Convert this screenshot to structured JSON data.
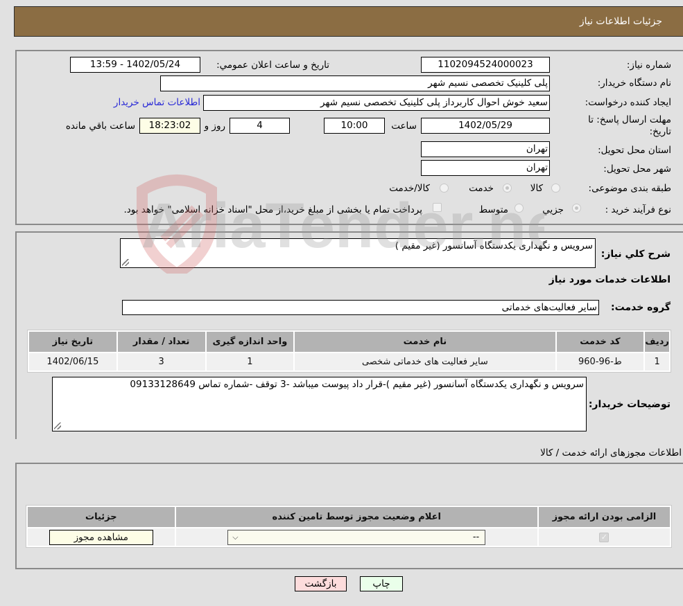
{
  "header": {
    "title": "جزئیات اطلاعات نیاز"
  },
  "details": {
    "need_number_label": "شماره نیاز:",
    "need_number": "1102094524000023",
    "announce_label": "تاريخ و ساعت اعلان عمومي:",
    "announce_value": "1402/05/24 - 13:59",
    "buyer_org_label": "نام دستگاه خریدار:",
    "buyer_org": "پلی کلینیک تخصصی نسیم شهر",
    "requester_label": "ایجاد کننده درخواست:",
    "requester": "سعید خوش احوال کاربرداز پلی کلینیک تخصصی نسیم شهر",
    "buyer_contact_link": "اطلاعات تماس خریدار",
    "deadline_label": "مهلت ارسال پاسخ: تا تاریخ:",
    "deadline_date": "1402/05/29",
    "time_label": "ساعت",
    "deadline_time": "10:00",
    "days": "4",
    "days_label": "روز و",
    "remaining_time": "18:23:02",
    "remaining_label": "ساعت باقي مانده",
    "province_label": "استان محل تحویل:",
    "province": "تهران",
    "city_label": "شهر محل تحویل:",
    "city": "تهران",
    "category_label": "طبقه بندی موضوعی:",
    "category_options": [
      {
        "label": "کالا",
        "checked": false
      },
      {
        "label": "خدمت",
        "checked": true
      },
      {
        "label": "کالا/خدمت",
        "checked": false
      }
    ],
    "purchase_type_label": "نوع فرآیند خرید :",
    "purchase_type_options": [
      {
        "label": "جزيي",
        "checked": true
      },
      {
        "label": "متوسط",
        "checked": false
      }
    ],
    "treasury_note": "پرداخت تمام یا بخشی از مبلغ خرید،از محل \"اسناد خزانه اسلامی\" خواهد بود."
  },
  "need": {
    "description_label": "شرح کلي نیاز:",
    "description": "سرویس و نگهداری یکدستگاه آسانسور (غیر مقیم )",
    "services_heading": "اطلاعات خدمات مورد نیاز",
    "service_group_label": "گروه خدمت:",
    "service_group": "سایر فعالیت‌های خدماتی",
    "table": {
      "headers": [
        "ردیف",
        "کد خدمت",
        "نام خدمت",
        "واحد اندازه گیری",
        "تعداد / مقدار",
        "تاریخ نیاز"
      ],
      "rows": [
        [
          "1",
          "ط-96-960",
          "سایر فعالیت های خدماتی شخصی",
          "1",
          "3",
          "1402/06/15"
        ]
      ]
    },
    "buyer_notes_label": "توضیحات خریدار:",
    "buyer_notes": "سرویس و نگهداری یکدستگاه آسانسور (غیر مقیم )-قرار داد پیوست میباشد -3 توقف -شماره تماس 09133128649"
  },
  "permits": {
    "heading": "اطلاعات مجوزهای ارائه خدمت / کالا",
    "headers": [
      "الزامی بودن ارائه مجوز",
      "اعلام وضعیت مجوز توسط تامین کننده",
      "جزئیات"
    ],
    "row": {
      "required_checked": true,
      "status_selected": "--",
      "view_button": "مشاهده مجوز"
    }
  },
  "actions": {
    "print": "چاپ",
    "back": "بازگشت"
  },
  "watermark": {
    "text": "AriaTender.neT"
  }
}
